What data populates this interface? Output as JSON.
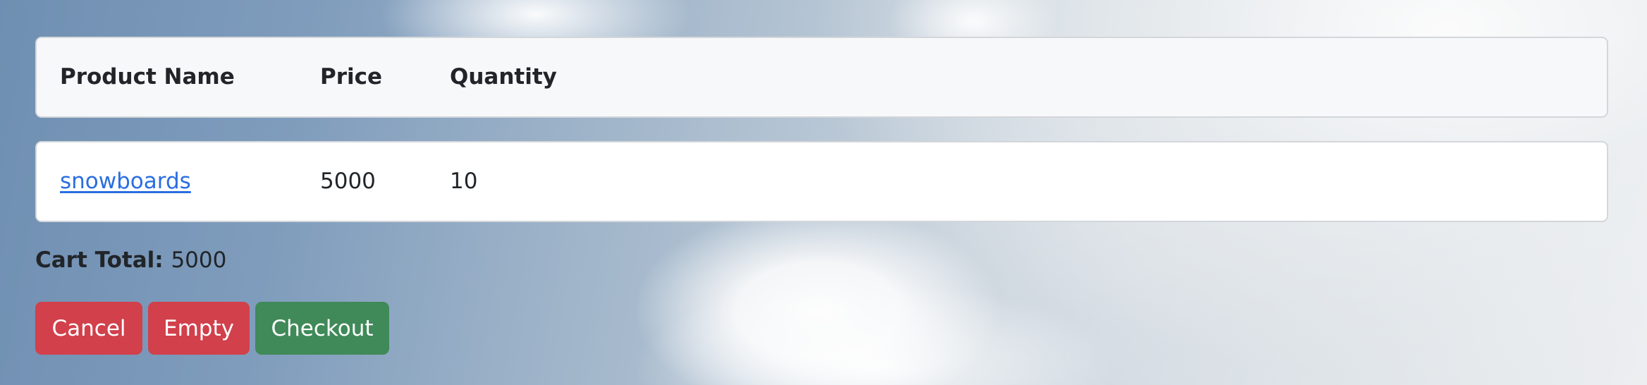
{
  "table": {
    "headers": {
      "name": "Product Name",
      "price": "Price",
      "quantity": "Quantity"
    },
    "rows": [
      {
        "name": "snowboards",
        "price": "5000",
        "quantity": "10"
      }
    ]
  },
  "cart": {
    "total_label": "Cart Total:",
    "total_value": "5000"
  },
  "actions": {
    "cancel": "Cancel",
    "empty": "Empty",
    "checkout": "Checkout"
  },
  "colors": {
    "danger": "#d1404b",
    "success": "#3f8a58",
    "link": "#2a6ee0"
  }
}
